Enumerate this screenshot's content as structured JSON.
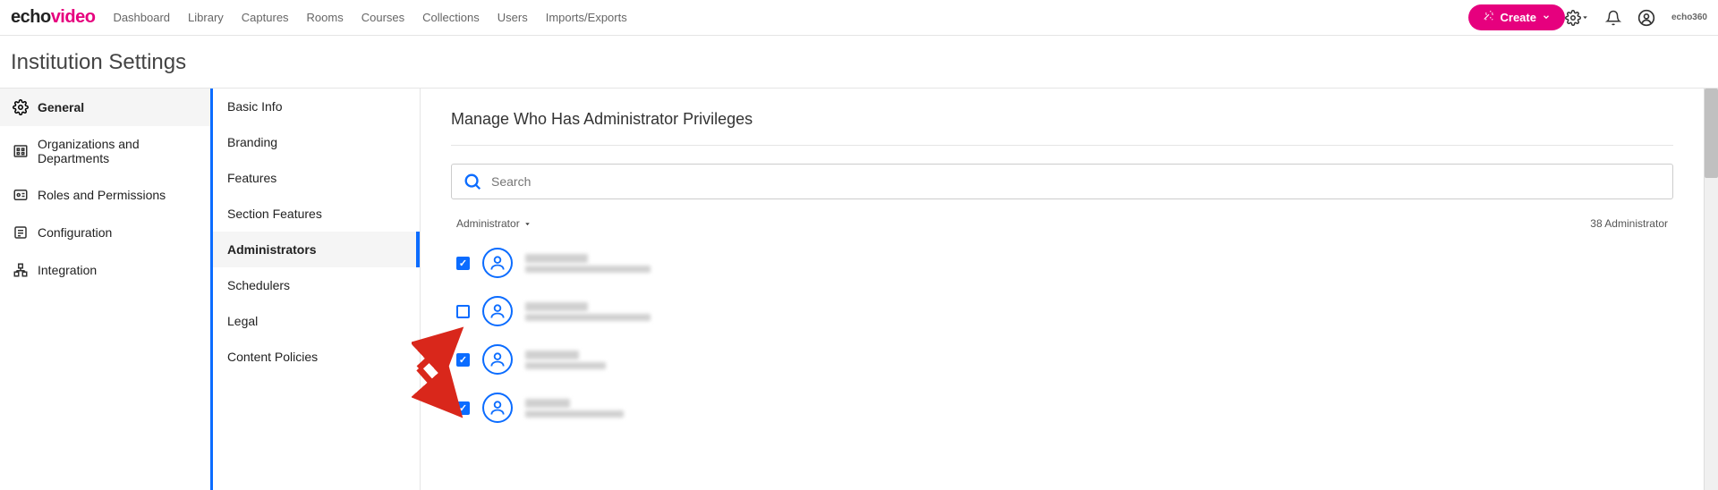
{
  "brand": {
    "part1": "echo",
    "part2": "video"
  },
  "topnav": [
    "Dashboard",
    "Library",
    "Captures",
    "Rooms",
    "Courses",
    "Collections",
    "Users",
    "Imports/Exports"
  ],
  "create_label": "Create",
  "brand_mark": "echo360",
  "page_title": "Institution Settings",
  "sidebar1": [
    {
      "label": "General",
      "icon": "gear",
      "active": true
    },
    {
      "label": "Organizations and Departments",
      "icon": "org",
      "active": false
    },
    {
      "label": "Roles and Permissions",
      "icon": "roles",
      "active": false
    },
    {
      "label": "Configuration",
      "icon": "config",
      "active": false
    },
    {
      "label": "Integration",
      "icon": "integration",
      "active": false
    }
  ],
  "sidebar2": [
    {
      "label": "Basic Info",
      "active": false
    },
    {
      "label": "Branding",
      "active": false
    },
    {
      "label": "Features",
      "active": false
    },
    {
      "label": "Section Features",
      "active": false
    },
    {
      "label": "Administrators",
      "active": true
    },
    {
      "label": "Schedulers",
      "active": false
    },
    {
      "label": "Legal",
      "active": false
    },
    {
      "label": "Content Policies",
      "active": false
    }
  ],
  "content": {
    "title": "Manage Who Has Administrator Privileges",
    "search_placeholder": "Search",
    "sort_label": "Administrator",
    "count_label": "38 Administrator"
  },
  "users": [
    {
      "checked": true
    },
    {
      "checked": false
    },
    {
      "checked": true
    },
    {
      "checked": true
    }
  ]
}
